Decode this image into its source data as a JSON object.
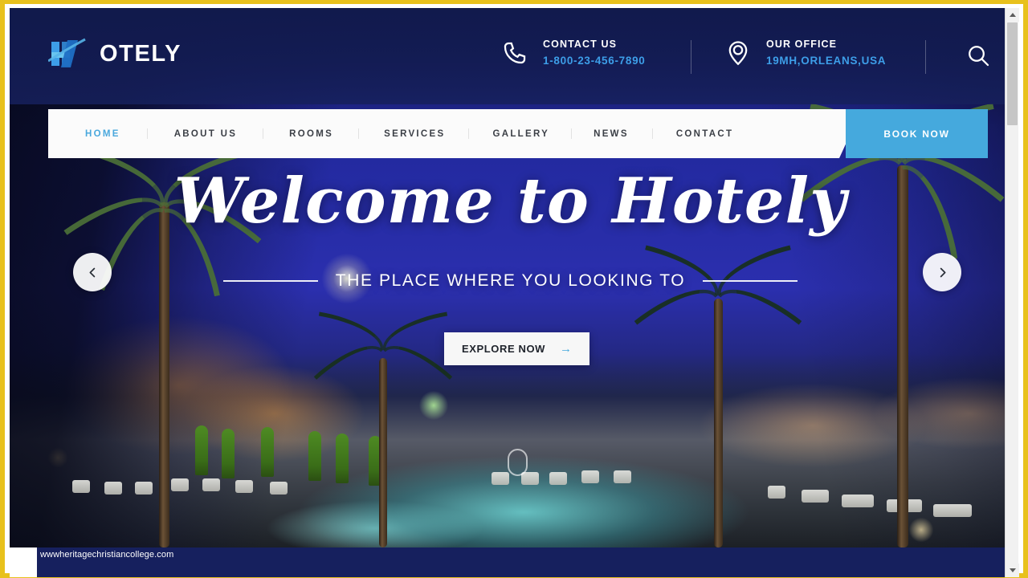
{
  "browser": {
    "status_text": "wwwheritagechristiancollege.com"
  },
  "header": {
    "logo": {
      "icon": "hotel-h-logo-icon",
      "text": "OTELY"
    },
    "contact": {
      "icon": "phone-icon",
      "label": "CONTACT US",
      "value": "1-800-23-456-7890"
    },
    "office": {
      "icon": "location-pin-icon",
      "label": "OUR OFFICE",
      "value": "19MH,ORLEANS,USA"
    },
    "search_icon": "search-icon"
  },
  "nav": {
    "items": [
      {
        "label": "HOME",
        "active": true
      },
      {
        "label": "ABOUT US",
        "active": false
      },
      {
        "label": "ROOMS",
        "active": false
      },
      {
        "label": "SERVICES",
        "active": false
      },
      {
        "label": "GALLERY",
        "active": false
      },
      {
        "label": "NEWS",
        "active": false
      },
      {
        "label": "CONTACT",
        "active": false
      }
    ],
    "book_now": "BOOK NOW"
  },
  "hero": {
    "title": "Welcome to Hotely",
    "subtitle": "THE PLACE WHERE YOU LOOKING TO",
    "cta_label": "EXPLORE NOW",
    "cta_arrow": "→",
    "prev_icon": "chevron-left-icon",
    "next_icon": "chevron-right-icon",
    "scroll_icon": "scroll-down-icon"
  },
  "colors": {
    "brand_blue": "#45a9dd",
    "header_navy": "#111a4d",
    "accent_link": "#3d9ee8",
    "frame_yellow": "#e8c11c"
  }
}
